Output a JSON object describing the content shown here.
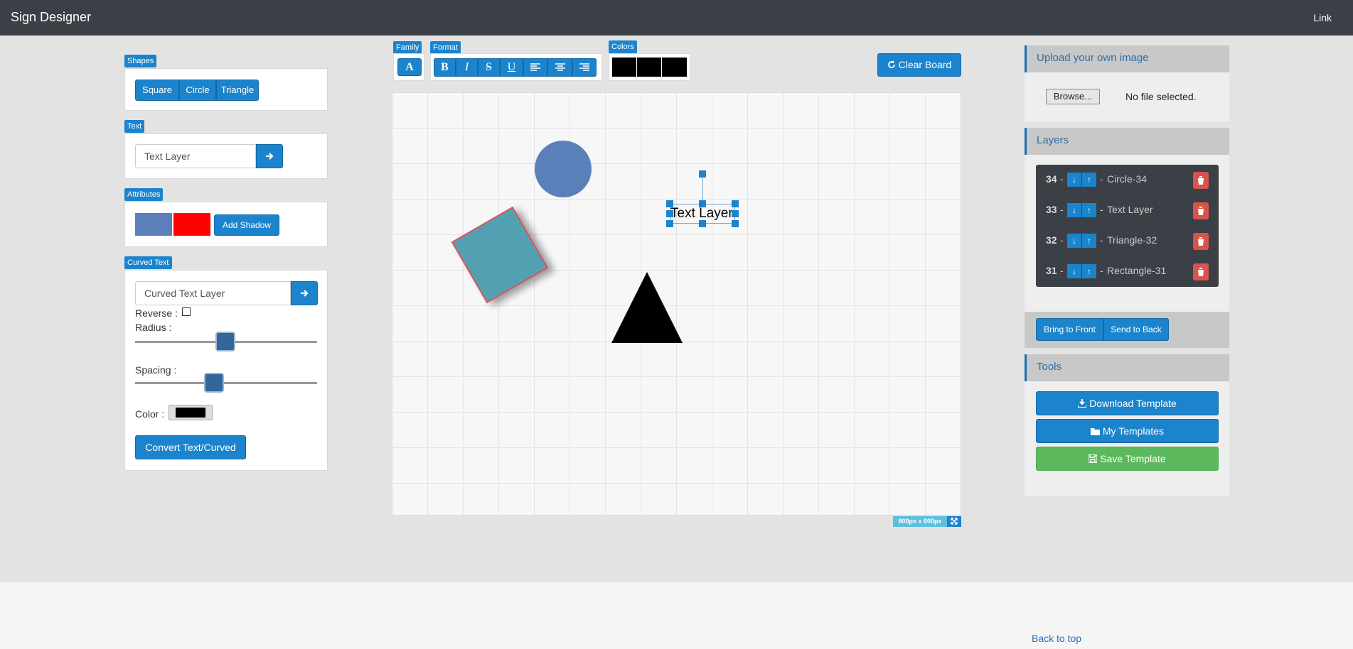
{
  "navbar": {
    "brand": "Sign Designer",
    "link": "Link"
  },
  "shapes": {
    "tag": "Shapes",
    "buttons": [
      "Square",
      "Circle",
      "Triangle"
    ]
  },
  "text": {
    "tag": "Text",
    "value": "Text Layer",
    "submit_icon": "arrow-right-icon"
  },
  "attributes": {
    "tag": "Attributes",
    "fill_color": "#5a7fb9",
    "stroke_color": "#ff0000",
    "shadow_label": "Add Shadow"
  },
  "curved": {
    "tag": "Curved Text",
    "value": "Curved Text Layer",
    "reverse_label": "Reverse :",
    "radius_label": "Radius :",
    "spacing_label": "Spacing :",
    "color_label": "Color :",
    "color": "#000000",
    "convert_label": "Convert Text/Curved"
  },
  "toolbar": {
    "family_tag": "Family",
    "family_glyph": "A",
    "format_tag": "Format",
    "format_buttons": [
      "B",
      "I",
      "S",
      "U"
    ],
    "colors_tag": "Colors",
    "swatches": [
      "#000000",
      "#000000",
      "#000000"
    ],
    "clear_label": "Clear Board"
  },
  "canvas": {
    "size_label": "800px x 600px",
    "text_layer": "Text Layer"
  },
  "upload": {
    "title": "Upload your own image",
    "browse": "Browse...",
    "status": "No file selected."
  },
  "layers": {
    "title": "Layers",
    "items": [
      {
        "num": "34",
        "name": "Circle-34"
      },
      {
        "num": "33",
        "name": "Text Layer"
      },
      {
        "num": "32",
        "name": "Triangle-32"
      },
      {
        "num": "31",
        "name": "Rectangle-31"
      }
    ],
    "front": "Bring to Front",
    "back": "Send to Back"
  },
  "tools": {
    "title": "Tools",
    "download": "Download Template",
    "my": "My Templates",
    "save": "Save Template"
  },
  "footer": {
    "back_to_top": "Back to top"
  }
}
